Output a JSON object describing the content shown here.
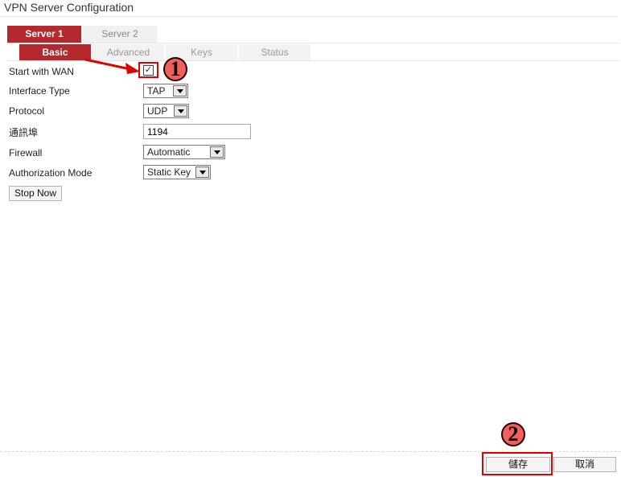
{
  "page": {
    "title": "VPN Server Configuration"
  },
  "server_tabs": [
    {
      "label": "Server 1",
      "active": true
    },
    {
      "label": "Server 2",
      "active": false
    }
  ],
  "sub_tabs": [
    {
      "label": "Basic",
      "active": true
    },
    {
      "label": "Advanced",
      "active": false
    },
    {
      "label": "Keys",
      "active": false
    },
    {
      "label": "Status",
      "active": false
    }
  ],
  "form": {
    "start_with_wan": {
      "label": "Start with WAN",
      "checked": true,
      "check_glyph": "✓"
    },
    "interface_type": {
      "label": "Interface Type",
      "value": "TAP"
    },
    "protocol": {
      "label": "Protocol",
      "value": "UDP"
    },
    "port": {
      "label": "通訊埠",
      "value": "1194"
    },
    "firewall": {
      "label": "Firewall",
      "value": "Automatic"
    },
    "authorization_mode": {
      "label": "Authorization Mode",
      "value": "Static Key"
    },
    "stop_button": {
      "label": "Stop Now"
    }
  },
  "annotations": {
    "callout_1": "1",
    "callout_2": "2",
    "highlight_color": "#e00000",
    "callout_color": "#f06060"
  },
  "footer": {
    "save_label": "儲存",
    "cancel_label": "取消"
  },
  "colors": {
    "accent": "#b4292e",
    "inactive_tab": "#f0f0f0"
  }
}
